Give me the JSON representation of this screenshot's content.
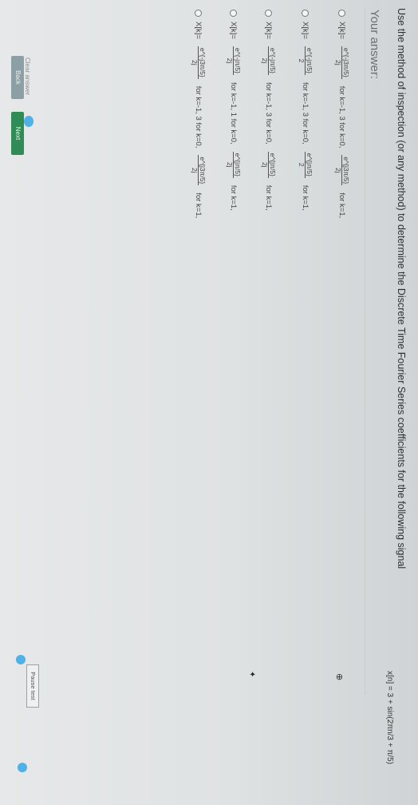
{
  "question": "Use the method of inspection (or any method) to determine the Discrete Time Fourier Series coefficients for the following signal",
  "signal": "x[n] = 3 + sin(2πn/3 + π/5)",
  "your_answer": "Your answer:",
  "options": [
    {
      "lhs": "X[k]=",
      "t1_num": "e^{-j3π/5}",
      "t1_den": "2j",
      "t1_text": "for k=-1, 3 for k=0,",
      "t2_num": "e^{j3π/5}",
      "t2_den": "2j",
      "t2_text": "for k=1,"
    },
    {
      "lhs": "X[k]=",
      "t1_num": "e^{-jπ/5}",
      "t1_den": "2",
      "t1_text": "for k=-1, 3 for k=0,",
      "t2_num": "e^{jπ/5}",
      "t2_den": "2",
      "t2_text": "for k=1,"
    },
    {
      "lhs": "X[k]=",
      "t1_num": "e^{-jπ/5}",
      "t1_den": "2j",
      "t1_text": "for k=-1, 3 for k=0,",
      "t2_num": "e^{jπ/5}",
      "t2_den": "2j",
      "t2_text": "for k=1,"
    },
    {
      "lhs": "X[k]=",
      "t1_num": "e^{-jπ/5}",
      "t1_den": "2j",
      "t1_text": "for k=-1, 1 for k=0,",
      "t2_num": "e^{jπ/5}",
      "t2_den": "2j",
      "t2_text": "for k=1,"
    },
    {
      "lhs": "X[k]=",
      "t1_num": "e^{-j3π/5}",
      "t1_den": "2j",
      "t1_text": "for k=-1, 3 for k=0,",
      "t2_num": "e^{j3π/5}",
      "t2_den": "2j",
      "t2_text": "for k=1,"
    }
  ],
  "clear_answer": "Clear answer",
  "back_label": "Back",
  "next_label": "Next",
  "pause_label": "Pause test",
  "colors": {
    "next_button": "#2f8c55",
    "back_button": "#8c9fa4",
    "focus_dot": "#4fb1e6"
  }
}
